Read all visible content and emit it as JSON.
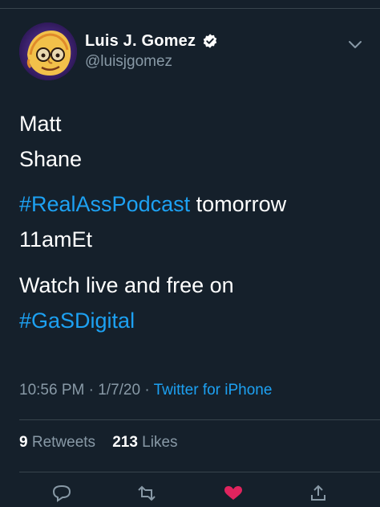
{
  "author": {
    "display_name": "Luis J. Gomez",
    "handle": "@luisjgomez",
    "verified_icon": "verified-badge-icon",
    "avatar_icon": "avatar-caricature"
  },
  "tweet": {
    "line1": "Matt",
    "line2": "Shane",
    "hashtag1": "#RealAssPodcast",
    "line3_rest": " tomorrow",
    "line4": "11amEt",
    "line5": "Watch live and free on",
    "hashtag2": "#GaSDigital"
  },
  "meta": {
    "time": "10:56 PM",
    "sep1": " · ",
    "date": "1/7/20",
    "sep2": " · ",
    "source": "Twitter for iPhone"
  },
  "stats": {
    "retweets_count": "9",
    "retweets_label": " Retweets",
    "likes_count": "213",
    "likes_label": " Likes"
  },
  "actions": [
    "reply-icon",
    "retweet-icon",
    "like-icon",
    "share-icon"
  ],
  "colors": {
    "background": "#15202b",
    "link": "#1da1f2",
    "secondary_text": "#8899a6",
    "divider": "#38444d",
    "like": "#e0245e"
  }
}
